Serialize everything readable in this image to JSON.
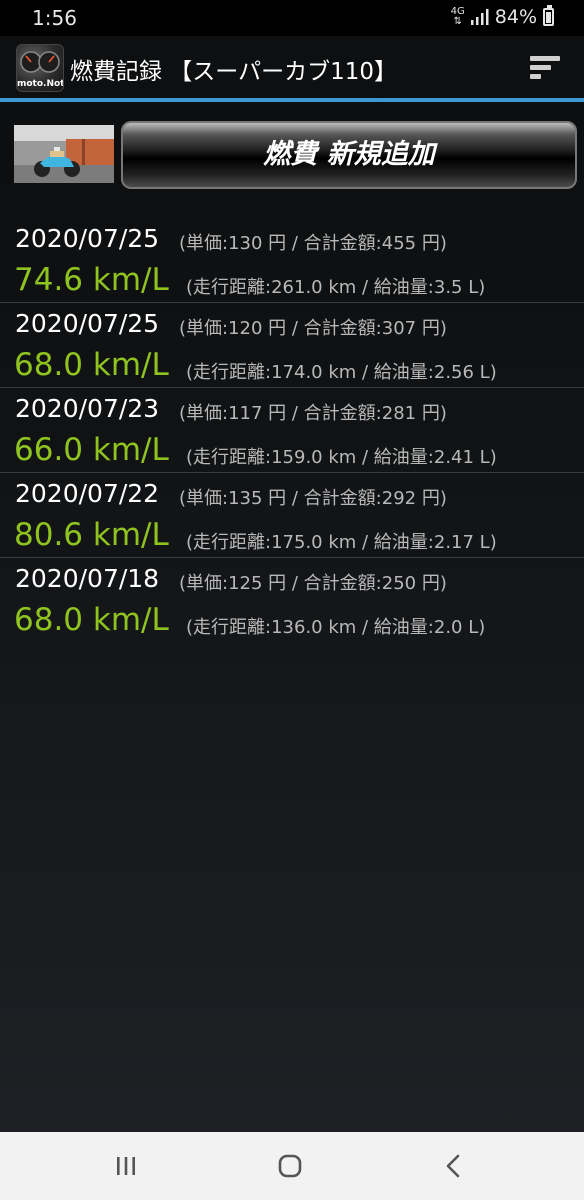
{
  "status_bar": {
    "time": "1:56",
    "network": "4G",
    "battery": "84%"
  },
  "header": {
    "app_icon_label": "moto.Note",
    "title": "燃費記録 【スーパーカブ110】",
    "menu_icon": "sort-menu-icon"
  },
  "add_button": {
    "label": "燃費 新規追加"
  },
  "records": [
    {
      "date": "2020/07/25",
      "price": "(単価:130 円 / 合計金額:455 円)",
      "efficiency": "74.6 km/L",
      "distance": "(走行距離:261.0 km / 給油量:3.5 L)"
    },
    {
      "date": "2020/07/25",
      "price": "(単価:120 円 / 合計金額:307 円)",
      "efficiency": "68.0 km/L",
      "distance": "(走行距離:174.0 km / 給油量:2.56 L)"
    },
    {
      "date": "2020/07/23",
      "price": "(単価:117 円 / 合計金額:281 円)",
      "efficiency": "66.0 km/L",
      "distance": "(走行距離:159.0 km / 給油量:2.41 L)"
    },
    {
      "date": "2020/07/22",
      "price": "(単価:135 円 / 合計金額:292 円)",
      "efficiency": "80.6 km/L",
      "distance": "(走行距離:175.0 km / 給油量:2.17 L)"
    },
    {
      "date": "2020/07/18",
      "price": "(単価:125 円 / 合計金額:250 円)",
      "efficiency": "68.0 km/L",
      "distance": "(走行距離:136.0 km / 給油量:2.0 L)"
    }
  ],
  "nav_bar": {
    "recents_icon": "recents-icon",
    "home_icon": "home-icon",
    "back_icon": "back-icon"
  },
  "colors": {
    "accent_line": "#3c9ad0",
    "efficiency_green": "#8fc31f",
    "secondary_text": "#b8b8b8"
  }
}
